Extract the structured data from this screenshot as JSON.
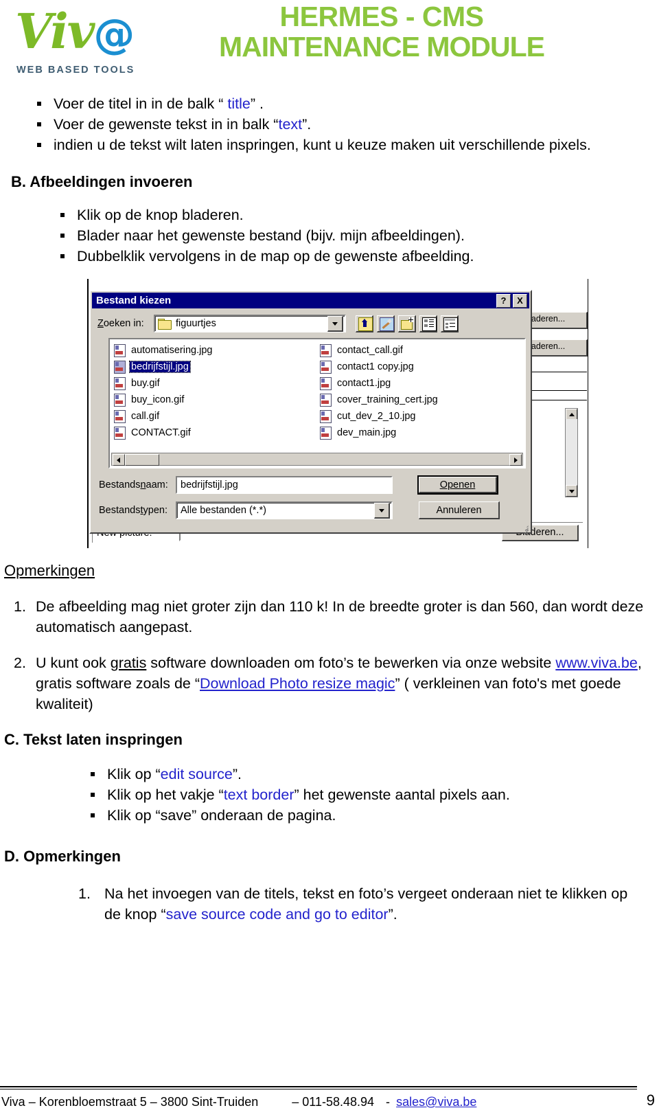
{
  "header": {
    "logo_word": "Viv",
    "logo_at": "@",
    "logo_subtitle": "WEB BASED TOOLS",
    "title_line1": "HERMES - CMS",
    "title_line2": "MAINTENANCE MODULE",
    "title_color": "#8cc63e",
    "logo_color": "#7dba28",
    "at_color": "#1b8fd1"
  },
  "intro_bullets": [
    {
      "pre": "Voer de titel in in de balk “ ",
      "hl": "title",
      "post": "” ."
    },
    {
      "pre": "Voer de gewenste tekst in in balk “",
      "hl": "text",
      "post": "”."
    },
    {
      "pre": "indien u de tekst wilt laten inspringen, kunt u keuze maken uit verschillende pixels.",
      "hl": "",
      "post": ""
    }
  ],
  "section_b": {
    "heading": "B. Afbeeldingen invoeren",
    "bullets": [
      "Klik op de knop bladeren.",
      "Blader naar het gewenste bestand (bijv. mijn afbeeldingen).",
      "Dubbelklik vervolgens in de map op de gewenste afbeelding."
    ]
  },
  "dialog": {
    "title": "Bestand kiezen",
    "help_button": "?",
    "close_button": "X",
    "lookin_label_pre": "Z",
    "lookin_label_post": "oeken in:",
    "lookin_value": "figuurtjes",
    "toolbar_icons": [
      "up-one-level-icon",
      "favorites-icon",
      "new-folder-icon",
      "list-view-icon",
      "details-view-icon"
    ],
    "files_col1": [
      {
        "name": "automatisering.jpg",
        "selected": false
      },
      {
        "name": "bedrijfstijl.jpg",
        "selected": true
      },
      {
        "name": "buy.gif",
        "selected": false
      },
      {
        "name": "buy_icon.gif",
        "selected": false
      },
      {
        "name": "call.gif",
        "selected": false
      },
      {
        "name": "CONTACT.gif",
        "selected": false
      }
    ],
    "files_col2": [
      {
        "name": "contact_call.gif",
        "selected": false
      },
      {
        "name": "contact1 copy.jpg",
        "selected": false
      },
      {
        "name": "contact1.jpg",
        "selected": false
      },
      {
        "name": "cover_training_cert.jpg",
        "selected": false
      },
      {
        "name": "cut_dev_2_10.jpg",
        "selected": false
      },
      {
        "name": "dev_main.jpg",
        "selected": false
      }
    ],
    "filename_label_pre": "Bestands",
    "filename_label_key": "n",
    "filename_label_post": "aam:",
    "filename_value": "bedrijfstijl.jpg",
    "filetype_label_pre": "Bestands",
    "filetype_label_key": "t",
    "filetype_label_post": "ypen:",
    "filetype_value": "Alle bestanden (*.*)",
    "open_button": "Openen",
    "cancel_button": "Annuleren"
  },
  "background_form": {
    "newpicture_label": "New picture:",
    "newpicture_value": "",
    "browse_button": "Bladeren...",
    "browse_button_2": "Bladeren...",
    "browse_button_3": "Bladeren..."
  },
  "opmerkingen": {
    "heading": "Opmerkingen",
    "item1_num": "1.",
    "item1_text": "De afbeelding mag niet groter zijn dan 110 k! In de breedte groter is dan 560, dan wordt deze automatisch aangepast.",
    "item2_num": "2.",
    "item2_a": "U kunt ook ",
    "item2_underline": "gratis",
    "item2_b": " software downloaden om foto’s te bewerken via onze website ",
    "item2_link1": "www.viva.be",
    "item2_c": ", gratis software zoals de “",
    "item2_link2": "Download Photo resize magic",
    "item2_d": "” ( verkleinen van foto's met goede kwaliteit)"
  },
  "section_c": {
    "heading": "C. Tekst laten inspringen",
    "bullets": [
      {
        "pre": "Klik op “",
        "hl": "edit source",
        "post": "”."
      },
      {
        "pre": "Klik op het vakje “",
        "hl": "text border",
        "post": "” het gewenste aantal pixels aan."
      },
      {
        "pre": "Klik op “save” onderaan de pagina.",
        "hl": "",
        "post": ""
      }
    ]
  },
  "section_d": {
    "heading": "D.  Opmerkingen",
    "item_num": "1.",
    "item_pre": "Na het invoegen van de titels, tekst en foto’s vergeet onderaan niet te klikken op de knop “",
    "item_hl": "save source code and go to editor",
    "item_post": "”."
  },
  "footer": {
    "address": "Viva – Korenbloemstraat 5 – 3800 Sint-Truiden",
    "phone": "– 011-58.48.94",
    "sep": "-",
    "email": "sales@viva.be",
    "page": "9"
  }
}
